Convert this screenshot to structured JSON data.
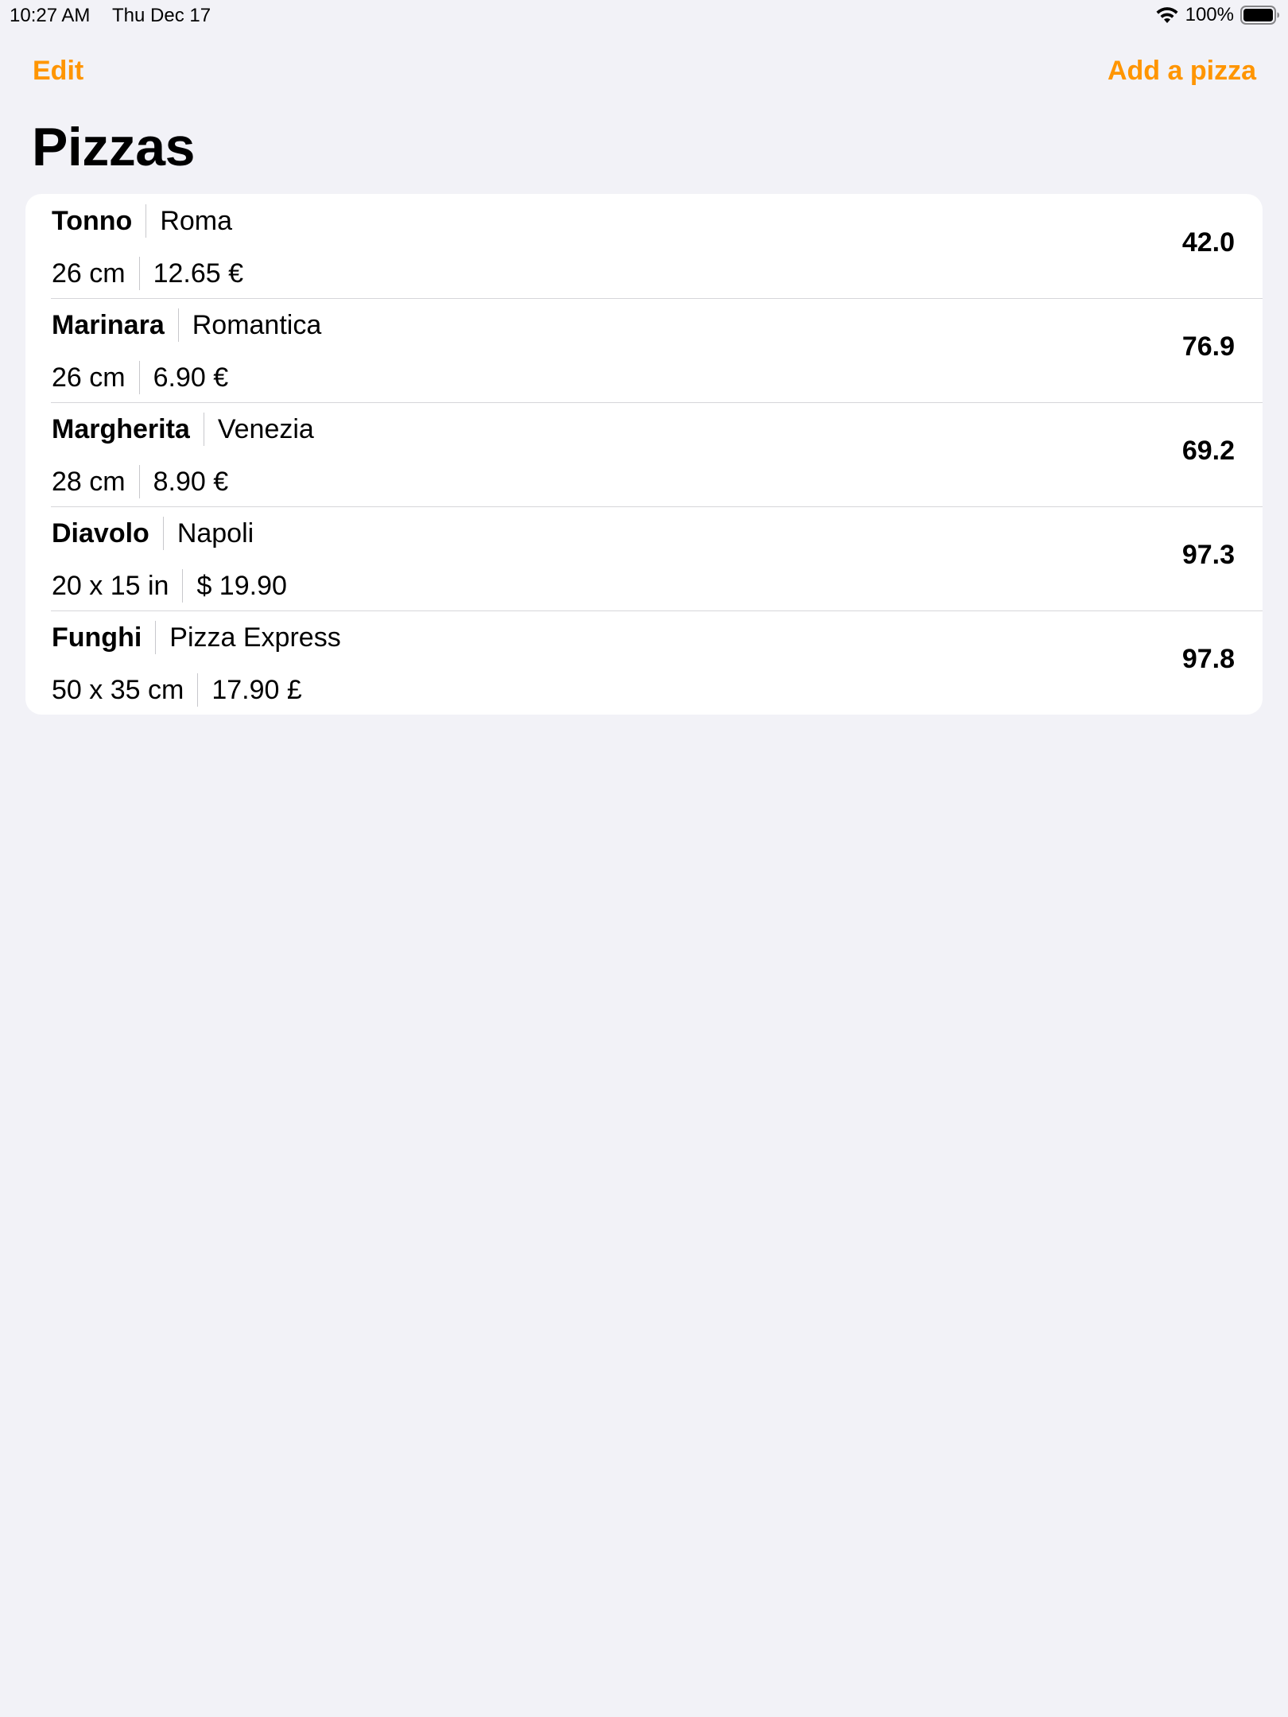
{
  "status_bar": {
    "time": "10:27 AM",
    "date": "Thu Dec 17",
    "battery": "100%",
    "wifi_icon": "wifi-icon",
    "battery_icon": "battery-icon"
  },
  "nav": {
    "edit_label": "Edit",
    "add_label": "Add a pizza",
    "accent_color": "#ff9500"
  },
  "page": {
    "title": "Pizzas"
  },
  "pizzas": [
    {
      "name": "Tonno",
      "restaurant": "Roma",
      "size": "26 cm",
      "price": "12.65 €",
      "score": "42.0"
    },
    {
      "name": "Marinara",
      "restaurant": "Romantica",
      "size": "26 cm",
      "price": "6.90 €",
      "score": "76.9"
    },
    {
      "name": "Margherita",
      "restaurant": "Venezia",
      "size": "28 cm",
      "price": "8.90 €",
      "score": "69.2"
    },
    {
      "name": "Diavolo",
      "restaurant": "Napoli",
      "size": "20 x 15 in",
      "price": "$ 19.90",
      "score": "97.3"
    },
    {
      "name": "Funghi",
      "restaurant": "Pizza Express",
      "size": "50 x 35 cm",
      "price": "17.90 £",
      "score": "97.8"
    }
  ]
}
